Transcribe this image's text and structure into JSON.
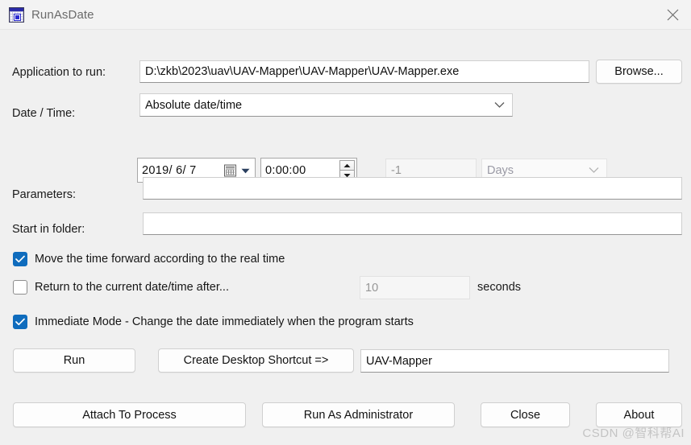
{
  "window": {
    "title": "RunAsDate",
    "icon": "calendar-icon",
    "close_label": "✕"
  },
  "form": {
    "app_to_run": {
      "label": "Application to run:",
      "value": "D:\\zkb\\2023\\uav\\UAV-Mapper\\UAV-Mapper\\UAV-Mapper.exe",
      "placeholder": ""
    },
    "browse_button": "Browse...",
    "date_time": {
      "label": "Date / Time:",
      "mode_value": "Absolute date/time",
      "date_value": "2019/ 6/ 7",
      "time_value": "0:00:00",
      "offset_value": "-1",
      "offset_unit": "Days"
    },
    "parameters": {
      "label": "Parameters:",
      "value": "",
      "placeholder": ""
    },
    "start_in_folder": {
      "label": "Start in folder:",
      "value": "",
      "placeholder": ""
    }
  },
  "options": {
    "move_time_forward": {
      "label": "Move the time forward according to the real time",
      "checked": true
    },
    "return_to_current": {
      "label": "Return to the current date/time after...",
      "checked": false,
      "seconds_value": "10",
      "seconds_label": "seconds"
    },
    "immediate_mode": {
      "label": "Immediate Mode - Change the date immediately when the program starts",
      "checked": true
    }
  },
  "actions": {
    "run": "Run",
    "create_shortcut": "Create Desktop Shortcut =>",
    "shortcut_name": "UAV-Mapper",
    "attach_to_process": "Attach To Process",
    "run_as_administrator": "Run As Administrator",
    "close": "Close",
    "about": "About"
  },
  "watermark": "CSDN @智科帮AI",
  "colors": {
    "accent": "#0f6cbd",
    "window_bg": "#f0f0f0",
    "titlebar_bg": "#f3f3f3",
    "field_bg": "#ffffff",
    "disabled_text": "#969696"
  }
}
